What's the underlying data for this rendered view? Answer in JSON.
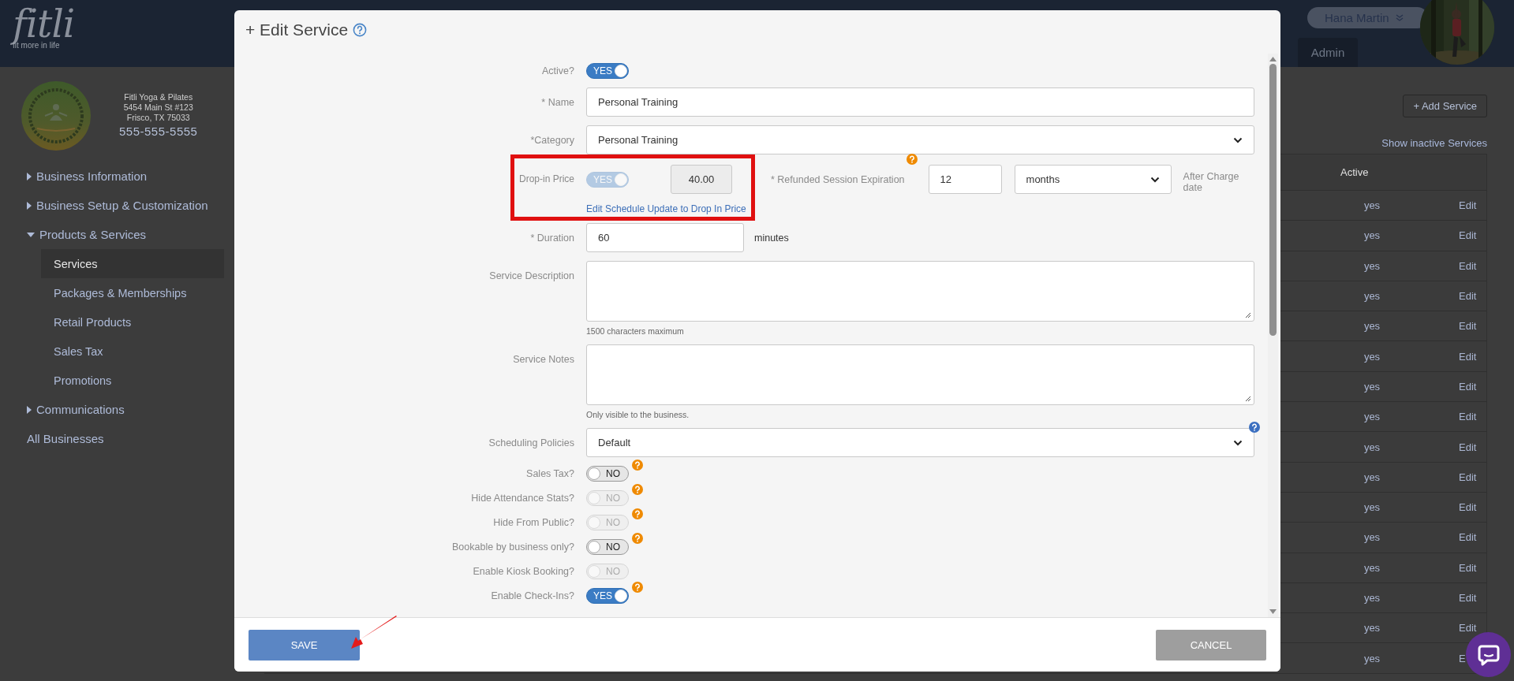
{
  "header": {
    "logo": "fitli",
    "tagline": "fit more in life",
    "user_name": "Hana Martin",
    "tab": "Admin"
  },
  "business": {
    "name": "Fitli Yoga & Pilates",
    "address_line_1": "5454 Main St #123",
    "address_line_2": "Frisco, TX 75033",
    "phone": "555-555-5555"
  },
  "sidebar": {
    "items": [
      {
        "kind": "group",
        "label": "Business Information",
        "expanded": false
      },
      {
        "kind": "group",
        "label": "Business Setup & Customization",
        "expanded": false
      },
      {
        "kind": "group",
        "label": "Products & Services",
        "expanded": true,
        "children": [
          {
            "label": "Services",
            "selected": true
          },
          {
            "label": "Packages & Memberships",
            "selected": false
          },
          {
            "label": "Retail Products",
            "selected": false
          },
          {
            "label": "Sales Tax",
            "selected": false
          },
          {
            "label": "Promotions",
            "selected": false
          }
        ]
      },
      {
        "kind": "group",
        "label": "Communications",
        "expanded": false
      },
      {
        "kind": "link",
        "label": "All Businesses"
      }
    ]
  },
  "services": {
    "add_button": "+ Add Service",
    "show_inactive_link": "Show inactive Services",
    "table": {
      "columns": [
        "Active"
      ],
      "rows": [
        {
          "active": "yes",
          "action": "Edit"
        },
        {
          "active": "yes",
          "action": "Edit"
        },
        {
          "active": "yes",
          "action": "Edit"
        },
        {
          "active": "yes",
          "action": "Edit"
        },
        {
          "active": "yes",
          "action": "Edit"
        },
        {
          "active": "yes",
          "action": "Edit"
        },
        {
          "active": "yes",
          "action": "Edit"
        },
        {
          "active": "yes",
          "action": "Edit"
        },
        {
          "active": "yes",
          "action": "Edit"
        },
        {
          "active": "yes",
          "action": "Edit"
        },
        {
          "active": "yes",
          "action": "Edit"
        },
        {
          "active": "yes",
          "action": "Edit"
        },
        {
          "active": "yes",
          "action": "Edit"
        },
        {
          "active": "yes",
          "action": "Edit"
        },
        {
          "active": "yes",
          "action": "Edit"
        },
        {
          "active": "yes",
          "action": "E"
        }
      ]
    }
  },
  "modal": {
    "title": "+ Edit Service",
    "fields": [
      {
        "kind": "toggle",
        "label": "Active?",
        "on": true,
        "disabled": false,
        "text": "YES",
        "help": false
      },
      {
        "kind": "text",
        "label": "* Name",
        "value": "Personal Training"
      },
      {
        "kind": "select",
        "label": "*Category",
        "value": "Personal Training",
        "help": false
      },
      {
        "kind": "dropin",
        "label": "Drop-in Price",
        "highlighted": true,
        "toggle": {
          "on": true,
          "disabled": true,
          "text": "YES"
        },
        "price": "40.00",
        "link": "Edit Schedule Update to Drop In Price",
        "expiration": {
          "label": "* Refunded Session Expiration",
          "help": true,
          "value": "12",
          "unit": "months",
          "suffix": "After Charge date"
        }
      },
      {
        "kind": "text",
        "label": "* Duration",
        "value": "60",
        "suffix": "minutes"
      },
      {
        "kind": "textarea",
        "label": "Service Description",
        "hint": "1500 characters maximum"
      },
      {
        "kind": "textarea",
        "label": "Service Notes",
        "hint": "Only visible to the business."
      },
      {
        "kind": "select",
        "label": "Scheduling Policies",
        "value": "Default",
        "help": true
      },
      {
        "kind": "toggle",
        "label": "Sales Tax?",
        "on": false,
        "disabled": false,
        "text": "NO",
        "help": true
      },
      {
        "kind": "toggle",
        "label": "Hide Attendance Stats?",
        "on": false,
        "disabled": true,
        "text": "NO",
        "help": true
      },
      {
        "kind": "toggle",
        "label": "Hide From Public?",
        "on": false,
        "disabled": true,
        "text": "NO",
        "help": true
      },
      {
        "kind": "toggle",
        "label": "Bookable by business only?",
        "on": false,
        "disabled": false,
        "text": "NO",
        "help": true
      },
      {
        "kind": "toggle",
        "label": "Enable Kiosk Booking?",
        "on": false,
        "disabled": true,
        "text": "NO",
        "help": false
      },
      {
        "kind": "toggle",
        "label": "Enable Check-Ins?",
        "on": true,
        "disabled": false,
        "text": "YES",
        "help": true
      }
    ],
    "save_button": "SAVE",
    "cancel_button": "CANCEL"
  }
}
